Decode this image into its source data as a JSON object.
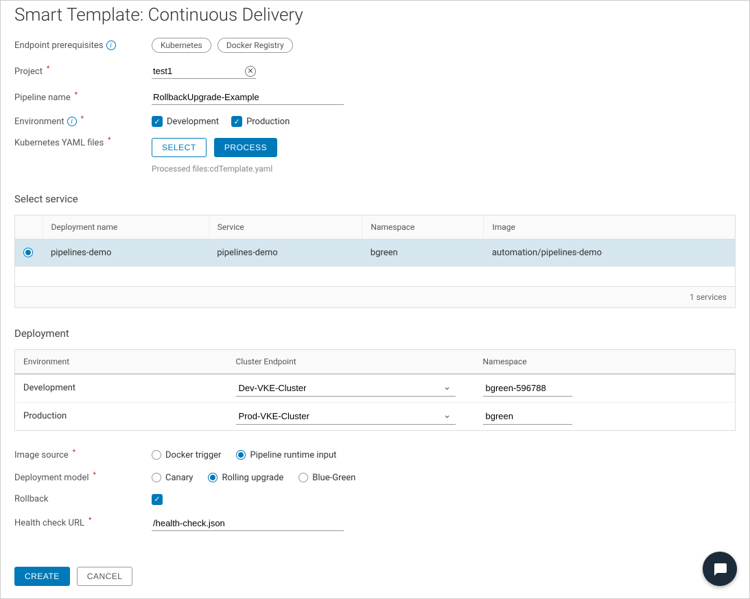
{
  "title": "Smart Template: Continuous Delivery",
  "labels": {
    "endpoint_prereq": "Endpoint prerequisites",
    "project": "Project",
    "pipeline_name": "Pipeline name",
    "environment": "Environment",
    "yaml_files": "Kubernetes YAML files",
    "select_service": "Select service",
    "deployment": "Deployment",
    "image_source": "Image source",
    "deployment_model": "Deployment model",
    "rollback": "Rollback",
    "health_url": "Health check URL"
  },
  "prereq_tags": [
    "Kubernetes",
    "Docker Registry"
  ],
  "project_value": "test1",
  "pipeline_name_value": "RollbackUpgrade-Example",
  "env_options": {
    "dev": "Development",
    "prod": "Production"
  },
  "buttons": {
    "select": "SELECT",
    "process": "PROCESS",
    "create": "CREATE",
    "cancel": "CANCEL"
  },
  "processed_text": "Processed files:cdTemplate.yaml",
  "service_table": {
    "headers": {
      "deployment": "Deployment name",
      "service": "Service",
      "namespace": "Namespace",
      "image": "Image"
    },
    "row": {
      "deployment": "pipelines-demo",
      "service": "pipelines-demo",
      "namespace": "bgreen",
      "image": "automation/pipelines-demo"
    },
    "footer": "1 services"
  },
  "deploy_table": {
    "headers": {
      "env": "Environment",
      "cluster": "Cluster Endpoint",
      "ns": "Namespace"
    },
    "rows": [
      {
        "env": "Development",
        "cluster": "Dev-VKE-Cluster",
        "ns": "bgreen-596788"
      },
      {
        "env": "Production",
        "cluster": "Prod-VKE-Cluster",
        "ns": "bgreen"
      }
    ]
  },
  "image_source_opts": {
    "docker": "Docker trigger",
    "runtime": "Pipeline runtime input"
  },
  "deploy_model_opts": {
    "canary": "Canary",
    "rolling": "Rolling upgrade",
    "bluegreen": "Blue-Green"
  },
  "health_url_value": "/health-check.json"
}
